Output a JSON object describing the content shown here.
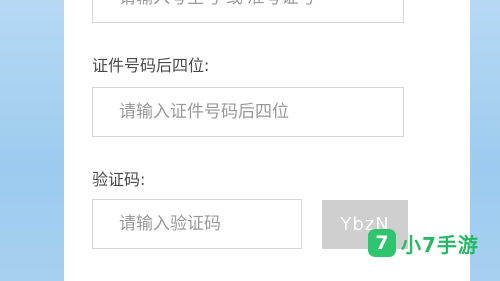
{
  "form": {
    "exam_id_placeholder": "请输入考生号 或 准考证号",
    "cert_label": "证件号码后四位:",
    "cert_placeholder": "请输入证件号码后四位",
    "captcha_label": "验证码:",
    "captcha_placeholder": "请输入验证码",
    "captcha_image_text": "YbzN"
  },
  "watermark": {
    "badge": "7",
    "text": "小7手游",
    "color": "#27b865"
  },
  "colors": {
    "background": "#a6d0f1",
    "card": "#ffffff",
    "captcha_bg": "#cfcfcf"
  }
}
